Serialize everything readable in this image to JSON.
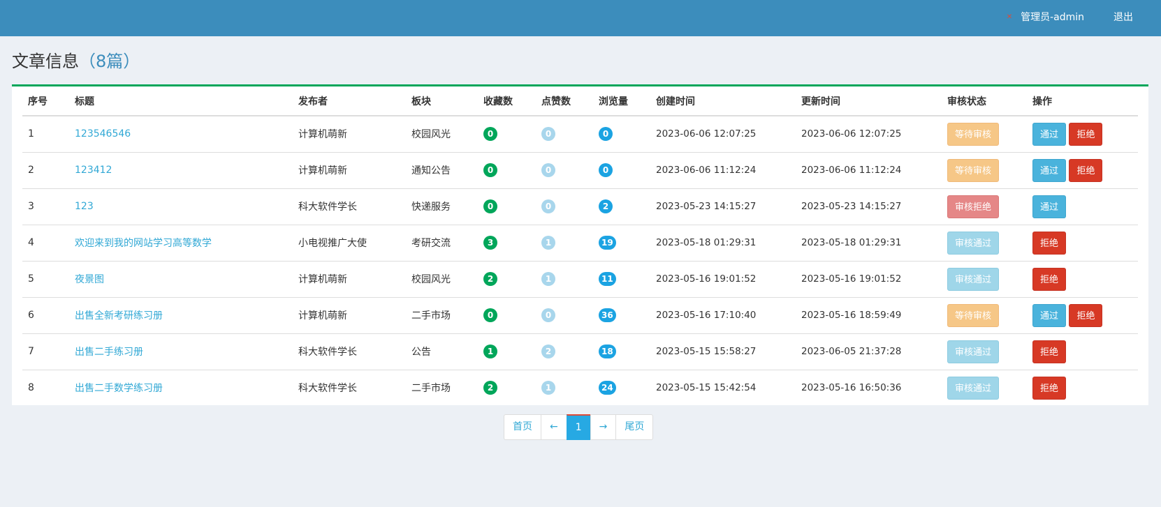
{
  "header": {
    "user_label": "管理员-admin",
    "logout_label": "退出"
  },
  "page": {
    "title": "文章信息",
    "count": "（8篇）"
  },
  "table": {
    "columns": [
      "序号",
      "标题",
      "发布者",
      "板块",
      "收藏数",
      "点赞数",
      "浏览量",
      "创建时间",
      "更新时间",
      "审核状态",
      "操作"
    ],
    "rows": [
      {
        "no": "1",
        "title": "123546546",
        "author": "计算机萌新",
        "section": "校园风光",
        "favorites": "0",
        "likes": "0",
        "views": "0",
        "created": "2023-06-06 12:07:25",
        "updated": "2023-06-06 12:07:25",
        "status": "等待审核",
        "status_type": "pending",
        "approve": "通过",
        "reject": "拒绝"
      },
      {
        "no": "2",
        "title": "123412",
        "author": "计算机萌新",
        "section": "通知公告",
        "favorites": "0",
        "likes": "0",
        "views": "0",
        "created": "2023-06-06 11:12:24",
        "updated": "2023-06-06 11:12:24",
        "status": "等待审核",
        "status_type": "pending",
        "approve": "通过",
        "reject": "拒绝"
      },
      {
        "no": "3",
        "title": "123",
        "author": "科大软件学长",
        "section": "快递服务",
        "favorites": "0",
        "likes": "0",
        "views": "2",
        "created": "2023-05-23 14:15:27",
        "updated": "2023-05-23 14:15:27",
        "status": "审核拒绝",
        "status_type": "rejected",
        "approve": "通过",
        "reject": null
      },
      {
        "no": "4",
        "title": "欢迎来到我的网站学习高等数学",
        "author": "小电视推广大使",
        "section": "考研交流",
        "favorites": "3",
        "likes": "1",
        "views": "19",
        "created": "2023-05-18 01:29:31",
        "updated": "2023-05-18 01:29:31",
        "status": "审核通过",
        "status_type": "approved",
        "approve": null,
        "reject": "拒绝"
      },
      {
        "no": "5",
        "title": "夜景图",
        "author": "计算机萌新",
        "section": "校园风光",
        "favorites": "2",
        "likes": "1",
        "views": "11",
        "created": "2023-05-16 19:01:52",
        "updated": "2023-05-16 19:01:52",
        "status": "审核通过",
        "status_type": "approved",
        "approve": null,
        "reject": "拒绝"
      },
      {
        "no": "6",
        "title": "出售全新考研练习册",
        "author": "计算机萌新",
        "section": "二手市场",
        "favorites": "0",
        "likes": "0",
        "views": "36",
        "created": "2023-05-16 17:10:40",
        "updated": "2023-05-16 18:59:49",
        "status": "等待审核",
        "status_type": "pending",
        "approve": "通过",
        "reject": "拒绝"
      },
      {
        "no": "7",
        "title": "出售二手练习册",
        "author": "科大软件学长",
        "section": "公告",
        "favorites": "1",
        "likes": "2",
        "views": "18",
        "created": "2023-05-15 15:58:27",
        "updated": "2023-06-05 21:37:28",
        "status": "审核通过",
        "status_type": "approved",
        "approve": null,
        "reject": "拒绝"
      },
      {
        "no": "8",
        "title": "出售二手数学练习册",
        "author": "科大软件学长",
        "section": "二手市场",
        "favorites": "2",
        "likes": "1",
        "views": "24",
        "created": "2023-05-15 15:42:54",
        "updated": "2023-05-16 16:50:36",
        "status": "审核通过",
        "status_type": "approved",
        "approve": null,
        "reject": "拒绝"
      }
    ]
  },
  "pagination": {
    "first": "首页",
    "prev": "←",
    "current": "1",
    "next": "→",
    "last": "尾页"
  }
}
